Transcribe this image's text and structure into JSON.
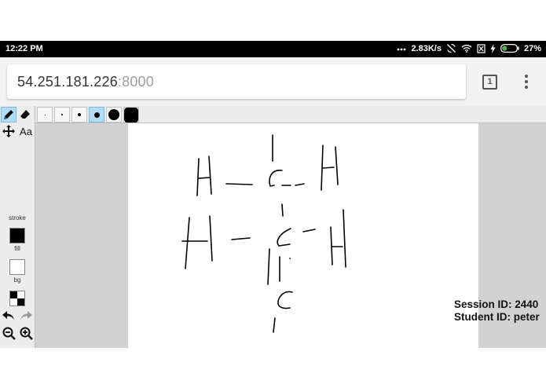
{
  "status_bar": {
    "time": "12:22 PM",
    "network_speed": "2.83K/s",
    "battery_percent": "27%",
    "icons": [
      "more-dots-icon",
      "sync-off-icon",
      "wifi-icon",
      "sim-icon",
      "charging-icon",
      "battery-icon"
    ]
  },
  "browser": {
    "url_host": "54.251.181.226",
    "url_port": ":8000",
    "tab_count": "1",
    "menu_icon": "vertical-dots-icon"
  },
  "toolbar": {
    "tools": [
      "pencil-icon",
      "eraser-icon",
      "move-icon",
      "text-icon"
    ],
    "text_tool_label": "Aa",
    "active_tool": "pencil",
    "stroke_label": "stroke",
    "fill_label": "fill",
    "bg_label": "bg",
    "stroke_color": "#000000",
    "bg_color": "#ffffff",
    "actions": [
      "undo-icon",
      "redo-icon",
      "zoom-out-icon",
      "zoom-in-icon"
    ]
  },
  "brush_sizes": {
    "count": 6,
    "active_index": 3
  },
  "canvas": {
    "ink_color": "#000000",
    "drawing": "handwritten hydrocarbon structure"
  },
  "session": {
    "session_text": "Session ID: 2440",
    "student_text": "Student ID: peter"
  },
  "colors": {
    "accent": "#b3dcf7",
    "toolbar_bg": "#ececec",
    "workspace_bg": "#d2d2d2"
  }
}
